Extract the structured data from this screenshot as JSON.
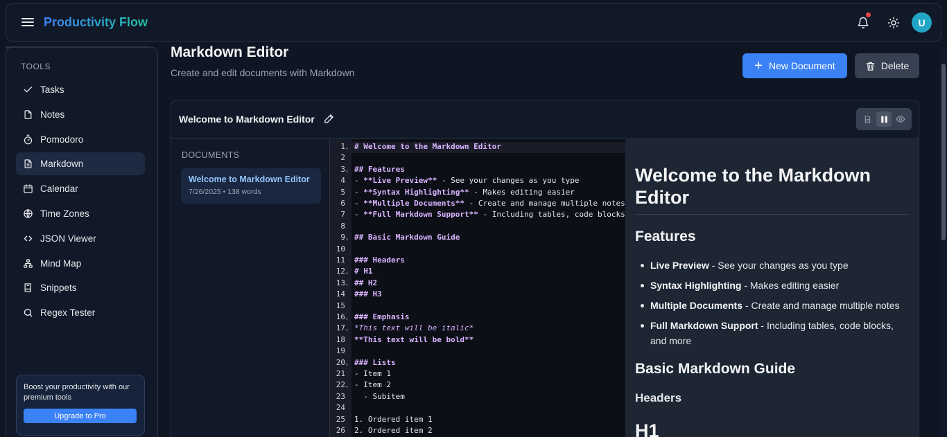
{
  "app": {
    "title": "Productivity Flow",
    "avatar_initial": "U"
  },
  "sidebar": {
    "section_label": "TOOLS",
    "items": [
      {
        "label": "Tasks",
        "icon": "check-icon"
      },
      {
        "label": "Notes",
        "icon": "file-icon"
      },
      {
        "label": "Pomodoro",
        "icon": "timer-icon"
      },
      {
        "label": "Markdown",
        "icon": "document-icon",
        "active": true
      },
      {
        "label": "Calendar",
        "icon": "calendar-icon"
      },
      {
        "label": "Time Zones",
        "icon": "globe-icon"
      },
      {
        "label": "JSON Viewer",
        "icon": "code-icon"
      },
      {
        "label": "Mind Map",
        "icon": "network-icon"
      },
      {
        "label": "Snippets",
        "icon": "book-icon"
      },
      {
        "label": "Regex Tester",
        "icon": "search-icon"
      }
    ],
    "promo": {
      "text": "Boost your productivity with our premium tools",
      "button": "Upgrade to Pro"
    }
  },
  "main": {
    "title": "Markdown Editor",
    "subtitle": "Create and edit documents with Markdown",
    "new_button": "New Document",
    "delete_button": "Delete"
  },
  "editor": {
    "doc_title": "Welcome to Markdown Editor",
    "documents_label": "DOCUMENTS",
    "documents": [
      {
        "title": "Welcome to Markdown Editor",
        "meta": "7/26/2025 • 138 words"
      }
    ],
    "code_lines": [
      {
        "n": "1",
        "text": "# Welcome to the Markdown Editor",
        "fold": true,
        "style": "h"
      },
      {
        "n": "2",
        "text": "",
        "fold": false,
        "style": ""
      },
      {
        "n": "3",
        "text": "## Features",
        "fold": true,
        "style": "h"
      },
      {
        "n": "4",
        "pre": "- ",
        "bold": "**Live Preview**",
        "post": " - See your changes as you type",
        "fold": false
      },
      {
        "n": "5",
        "pre": "- ",
        "bold": "**Syntax Highlighting**",
        "post": " - Makes editing easier",
        "fold": false
      },
      {
        "n": "6",
        "pre": "- ",
        "bold": "**Multiple Documents**",
        "post": " - Create and manage multiple notes",
        "fold": false
      },
      {
        "n": "7",
        "pre": "- ",
        "bold": "**Full Markdown Support**",
        "post": " - Including tables, code blocks, and more",
        "fold": false
      },
      {
        "n": "8",
        "text": "",
        "fold": false,
        "style": ""
      },
      {
        "n": "9",
        "text": "## Basic Markdown Guide",
        "fold": true,
        "style": "h"
      },
      {
        "n": "10",
        "text": "",
        "fold": false,
        "style": ""
      },
      {
        "n": "11",
        "text": "### Headers",
        "fold": false,
        "style": "h"
      },
      {
        "n": "12",
        "text": "# H1",
        "fold": true,
        "style": "h"
      },
      {
        "n": "13",
        "text": "## H2",
        "fold": true,
        "style": "h"
      },
      {
        "n": "14",
        "text": "### H3",
        "fold": false,
        "style": "h"
      },
      {
        "n": "15",
        "text": "",
        "fold": false,
        "style": ""
      },
      {
        "n": "16",
        "text": "### Emphasis",
        "fold": true,
        "style": "h"
      },
      {
        "n": "17",
        "text": "*This text will be italic*",
        "fold": true,
        "style": "i"
      },
      {
        "n": "18",
        "text": "**This text will be bold**",
        "fold": false,
        "style": "h"
      },
      {
        "n": "19",
        "text": "",
        "fold": false,
        "style": ""
      },
      {
        "n": "20",
        "text": "### Lists",
        "fold": true,
        "style": "h"
      },
      {
        "n": "21",
        "text": "- Item 1",
        "fold": false,
        "style": ""
      },
      {
        "n": "22",
        "text": "- Item 2",
        "fold": true,
        "style": ""
      },
      {
        "n": "23",
        "text": "  - Subitem",
        "fold": false,
        "style": ""
      },
      {
        "n": "24",
        "text": "",
        "fold": false,
        "style": ""
      },
      {
        "n": "25",
        "text": "1. Ordered item 1",
        "fold": false,
        "style": ""
      },
      {
        "n": "26",
        "text": "2. Ordered item 2",
        "fold": false,
        "style": ""
      }
    ],
    "preview": {
      "h1": "Welcome to the Markdown Editor",
      "features_heading": "Features",
      "features": [
        {
          "bold": "Live Preview",
          "text": " - See your changes as you type"
        },
        {
          "bold": "Syntax Highlighting",
          "text": " - Makes editing easier"
        },
        {
          "bold": "Multiple Documents",
          "text": " - Create and manage multiple notes"
        },
        {
          "bold": "Full Markdown Support",
          "text": " - Including tables, code blocks, and more"
        }
      ],
      "guide_heading": "Basic Markdown Guide",
      "headers_heading": "Headers",
      "h1_sample": "H1"
    }
  },
  "colors": {
    "accent": "#3b82f6",
    "notification": "#ef4444",
    "avatar": "#22a6c8"
  }
}
